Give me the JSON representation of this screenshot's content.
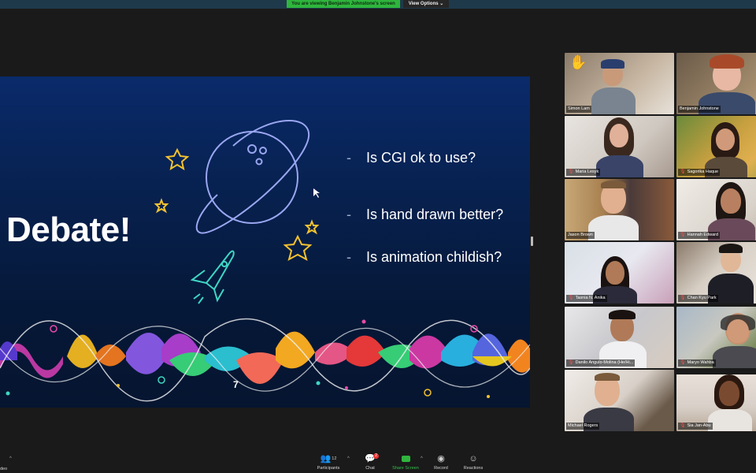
{
  "banner": {
    "viewing_text": "You are viewing Benjamin Johnstone's screen",
    "view_options_label": "View Options ⌄"
  },
  "slide": {
    "title": "Debate!",
    "bullets": [
      "Is CGI ok to use?",
      "Is hand drawn better?",
      "Is animation childish?"
    ],
    "bullet_marker": "-",
    "page_number": "7",
    "decor_icons": [
      "planet-icon",
      "rocket-icon",
      "star-icon",
      "sound-wave"
    ]
  },
  "participants": [
    {
      "name": "Simon Lam",
      "muted": false,
      "hand_raised": true,
      "hand_emoji": "✋"
    },
    {
      "name": "Benjamin Johnstone",
      "muted": false
    },
    {
      "name": "Maria Lesyk",
      "muted": true
    },
    {
      "name": "Sagorika Haque",
      "muted": true
    },
    {
      "name": "Jason Brown",
      "muted": false
    },
    {
      "name": "Hannah Edward",
      "muted": true
    },
    {
      "name": "Tasnia N. Anika",
      "muted": true
    },
    {
      "name": "Chan Kyu Park",
      "muted": true
    },
    {
      "name": "Danilo Angulo-Molina (He/Hi...",
      "muted": true
    },
    {
      "name": "Maryo Wahba",
      "muted": true
    },
    {
      "name": "Michael Rogers",
      "muted": false,
      "active_speaker": true
    },
    {
      "name": "Sia Jan-Abu",
      "muted": true
    }
  ],
  "toolbar": {
    "video_label": "deo",
    "participants_label": "Participants",
    "participants_count": "12",
    "chat_label": "Chat",
    "chat_badge": "2",
    "share_label": "Share Screen",
    "record_label": "Record",
    "reactions_label": "Reactions"
  },
  "colors": {
    "share_green": "#2fb53d",
    "active_speaker_outline": "#d9e65a",
    "slide_bg": "#07214f",
    "mute_red": "#ff4a4a"
  }
}
